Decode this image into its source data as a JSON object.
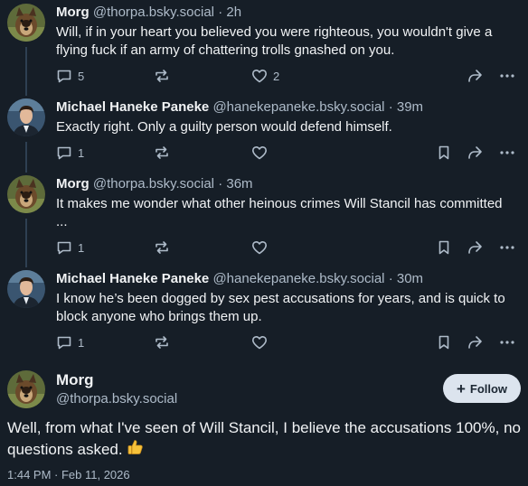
{
  "posts": [
    {
      "name": "Morg",
      "handle": "@thorpa.bsky.social",
      "time": "2h",
      "text": "Will, if in your heart you believed you were righteous, you wouldn't give a flying fuck if an army of chattering trolls gnashed on you.",
      "reply_count": "5",
      "repost_count": "",
      "like_count": "2",
      "avatar": "dog-avatar"
    },
    {
      "name": "Michael Haneke Paneke",
      "handle": "@hanekepaneke.bsky.social",
      "time": "39m",
      "text": "Exactly right. Only a guilty person would defend himself.",
      "reply_count": "1",
      "repost_count": "",
      "like_count": "",
      "avatar": "man-avatar"
    },
    {
      "name": "Morg",
      "handle": "@thorpa.bsky.social",
      "time": "36m",
      "text": "It makes me wonder what other heinous crimes Will Stancil has committed ...",
      "reply_count": "1",
      "repost_count": "",
      "like_count": "",
      "avatar": "dog-avatar"
    },
    {
      "name": "Michael Haneke Paneke",
      "handle": "@hanekepaneke.bsky.social",
      "time": "30m",
      "text": "I know he’s been dogged by sex pest accusations for years, and is quick to block anyone who brings them up.",
      "reply_count": "1",
      "repost_count": "",
      "like_count": "",
      "avatar": "man-avatar"
    }
  ],
  "separator": "·",
  "main_post": {
    "name": "Morg",
    "handle": "@thorpa.bsky.social",
    "follow_label": "Follow",
    "text": "Well, from what I've seen of Will Stancil, I believe the accusations 100%, no questions asked.",
    "emoji": "thumbs-up",
    "date": "1:44 PM · Feb 11, 2026"
  },
  "icons": [
    "reply-icon",
    "repost-icon",
    "like-icon",
    "bookmark-icon",
    "share-icon",
    "more-icon",
    "plus-icon"
  ],
  "colors": {
    "background": "#161e27",
    "text": "#f1f3f5",
    "muted": "#aebbc9",
    "thread_line": "#2e4052",
    "follow_bg": "#dce4ee"
  }
}
